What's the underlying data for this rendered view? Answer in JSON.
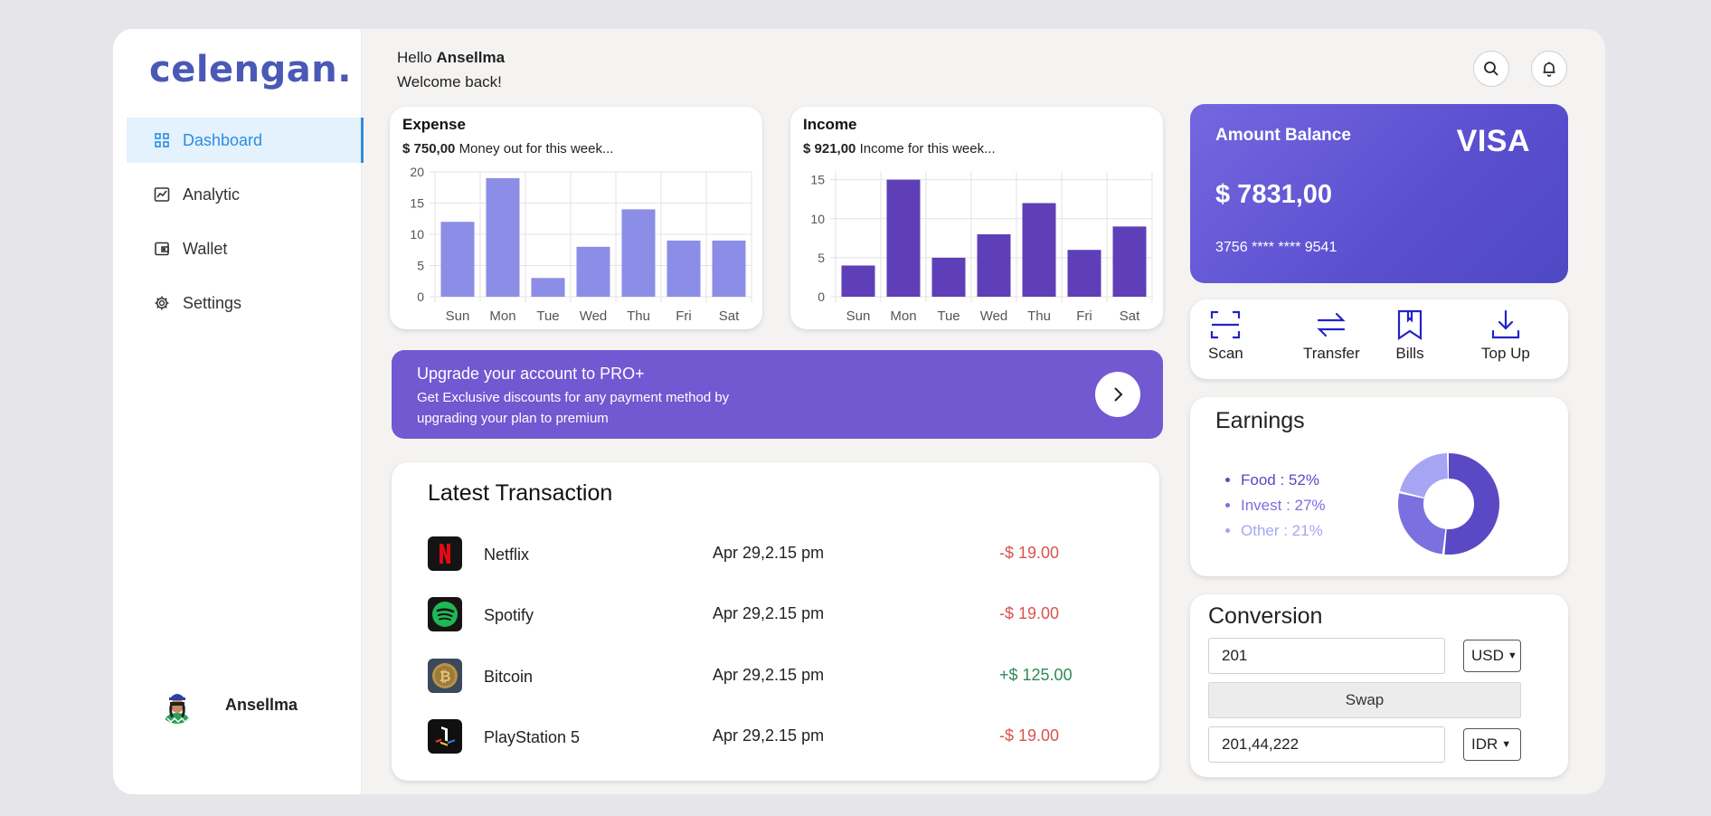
{
  "brand": {
    "logo": "celengan."
  },
  "sidebar": {
    "items": [
      {
        "label": "Dashboard",
        "icon": "grid-icon",
        "active": true
      },
      {
        "label": "Analytic",
        "icon": "chart-line-icon"
      },
      {
        "label": "Wallet",
        "icon": "wallet-icon"
      },
      {
        "label": "Settings",
        "icon": "gear-icon"
      }
    ],
    "user": {
      "name": "Ansellma"
    }
  },
  "header": {
    "hello": "Hello",
    "name": "Ansellma",
    "welcome": "Welcome back!"
  },
  "expense": {
    "title": "Expense",
    "amount": "$ 750,00",
    "note": "Money out for this week...",
    "color": "#8b8de6"
  },
  "income": {
    "title": "Income",
    "amount": "$ 921,00",
    "note": "Income for this week...",
    "color": "#5e3fb8"
  },
  "chart_data": [
    {
      "type": "bar",
      "categories": [
        "Sun",
        "Mon",
        "Tue",
        "Wed",
        "Thu",
        "Fri",
        "Sat"
      ],
      "values": [
        12,
        19,
        3,
        8,
        14,
        9,
        9
      ],
      "ylim": [
        0,
        20
      ],
      "yticks": [
        0,
        5,
        10,
        15,
        20
      ],
      "grid": true
    },
    {
      "type": "bar",
      "categories": [
        "Sun",
        "Mon",
        "Tue",
        "Wed",
        "Thu",
        "Fri",
        "Sat"
      ],
      "values": [
        4,
        15,
        5,
        8,
        12,
        6,
        9
      ],
      "ylim": [
        0,
        16
      ],
      "yticks": [
        0,
        5,
        10,
        15
      ],
      "grid": true
    }
  ],
  "promo": {
    "title": "Upgrade your account to PRO+",
    "desc": "Get Exclusive discounts for any payment method by upgrading your plan to premium"
  },
  "transactions": {
    "title": "Latest Transaction",
    "rows": [
      {
        "name": "Netflix",
        "date": "Apr 29,2.15 pm",
        "amount": "-$ 19.00",
        "icon": "netflix-icon"
      },
      {
        "name": "Spotify",
        "date": "Apr 29,2.15 pm",
        "amount": "-$ 19.00",
        "icon": "spotify-icon"
      },
      {
        "name": "Bitcoin",
        "date": "Apr 29,2.15 pm",
        "amount": "+$ 125.00",
        "icon": "bitcoin-icon"
      },
      {
        "name": "PlayStation 5",
        "date": "Apr 29,2.15 pm",
        "amount": "-$ 19.00",
        "icon": "playstation-icon"
      }
    ],
    "colors": {
      "negative": "#d9534f",
      "positive": "#2e8b57"
    }
  },
  "balance": {
    "label": "Amount Balance",
    "brand": "VISA",
    "amount": "$ 7831,00",
    "card": "3756 **** **** 9541"
  },
  "actions": [
    {
      "label": "Scan",
      "icon": "scan-icon"
    },
    {
      "label": "Transfer",
      "icon": "transfer-icon"
    },
    {
      "label": "Bills",
      "icon": "bookmark-icon"
    },
    {
      "label": "Top Up",
      "icon": "download-icon"
    }
  ],
  "earnings": {
    "title": "Earnings",
    "items": [
      {
        "label": "Food : 52%",
        "value": 52,
        "color": "#5a48c4"
      },
      {
        "label": "Invest : 27%",
        "value": 27,
        "color": "#7b70e0"
      },
      {
        "label": "Other : 21%",
        "value": 21,
        "color": "#a6a5f3"
      }
    ]
  },
  "conversion": {
    "title": "Conversion",
    "from_value": "201",
    "from_currency": "USD",
    "swap_label": "Swap",
    "to_value": "201,44,222",
    "to_currency": "IDR"
  }
}
